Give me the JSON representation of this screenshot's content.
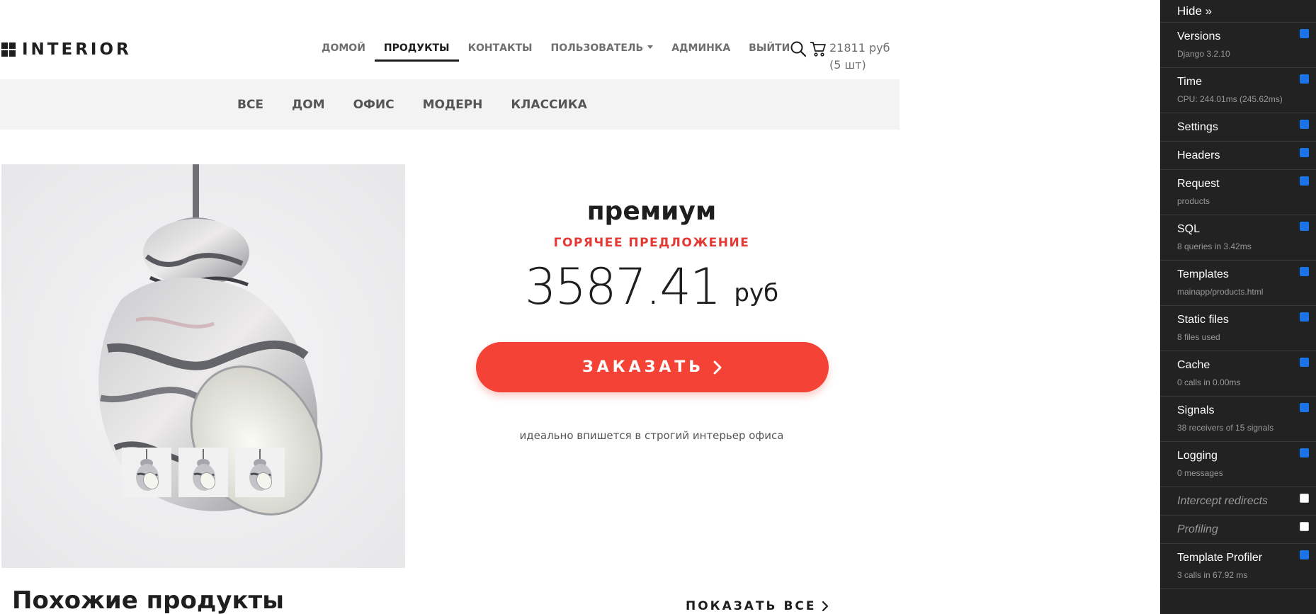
{
  "brand": {
    "logo_text": "INTERIOR"
  },
  "nav": {
    "items": [
      {
        "label": "ДОМОЙ"
      },
      {
        "label": "ПРОДУКТЫ"
      },
      {
        "label": "КОНТАКТЫ"
      },
      {
        "label": "ПОЛЬЗОВАТЕЛЬ"
      },
      {
        "label": "АДМИНКА"
      },
      {
        "label": "ВЫЙТИ"
      }
    ],
    "active": "ПРОДУКТЫ"
  },
  "cart": {
    "total": "21811 руб",
    "count": "(5 шт)"
  },
  "categories": [
    {
      "label": "ВСЕ"
    },
    {
      "label": "ДОМ"
    },
    {
      "label": "ОФИС"
    },
    {
      "label": "МОДЕРН"
    },
    {
      "label": "КЛАССИКА"
    }
  ],
  "product": {
    "name": "премиум",
    "tag": "ГОРЯЧЕЕ ПРЕДЛОЖЕНИЕ",
    "price": "3587.41",
    "currency": "руб",
    "order_label": "ЗАКАЗАТЬ",
    "description": "идеально впишется в строгий интерьер офиса",
    "thumbnails": 3
  },
  "related": {
    "title": "Похожие продукты",
    "show_all": "ПОКАЗАТЬ ВСЕ"
  },
  "debug_toolbar": {
    "hide_label": "Hide »",
    "panels": [
      {
        "title": "Versions",
        "sub": "Django 3.2.10",
        "checked": true
      },
      {
        "title": "Time",
        "sub": "CPU: 244.01ms (245.62ms)",
        "checked": true
      },
      {
        "title": "Settings",
        "sub": "",
        "checked": true
      },
      {
        "title": "Headers",
        "sub": "",
        "checked": true
      },
      {
        "title": "Request",
        "sub": "products",
        "checked": true
      },
      {
        "title": "SQL",
        "sub": "8 queries in 3.42ms",
        "checked": true
      },
      {
        "title": "Templates",
        "sub": "mainapp/products.html",
        "checked": true
      },
      {
        "title": "Static files",
        "sub": "8 files used",
        "checked": true
      },
      {
        "title": "Cache",
        "sub": "0 calls in 0.00ms",
        "checked": true
      },
      {
        "title": "Signals",
        "sub": "38 receivers of 15 signals",
        "checked": true
      },
      {
        "title": "Logging",
        "sub": "0 messages",
        "checked": true
      },
      {
        "title": "Intercept redirects",
        "sub": "",
        "checked": false
      },
      {
        "title": "Profiling",
        "sub": "",
        "checked": false
      },
      {
        "title": "Template Profiler",
        "sub": "3 calls in 67.92 ms",
        "checked": true
      }
    ]
  },
  "colors": {
    "accent": "#f44336",
    "hot": "#e53935",
    "toolbar_bg": "#222222",
    "checkbox": "#1a73e8"
  }
}
